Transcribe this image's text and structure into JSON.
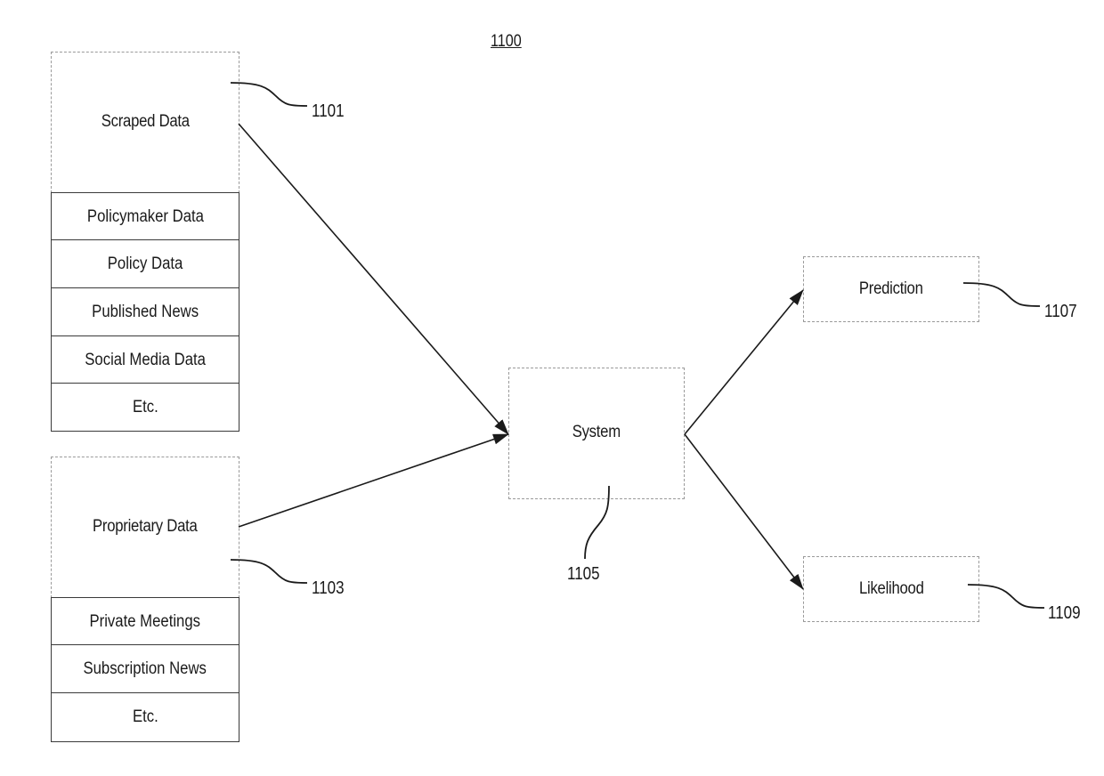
{
  "figure_number": "1100",
  "scraped": {
    "title": "Scraped Data",
    "ref": "1101",
    "items": [
      "Policymaker Data",
      "Policy Data",
      "Published News",
      "Social Media Data",
      "Etc."
    ]
  },
  "proprietary": {
    "title": "Proprietary Data",
    "ref": "1103",
    "items": [
      "Private Meetings",
      "Subscription News",
      "Etc."
    ]
  },
  "system": {
    "title": "System",
    "ref": "1105"
  },
  "prediction": {
    "title": "Prediction",
    "ref": "1107"
  },
  "likelihood": {
    "title": "Likelihood",
    "ref": "1109"
  },
  "edges": [
    {
      "from": "scraped",
      "to": "system"
    },
    {
      "from": "proprietary",
      "to": "system"
    },
    {
      "from": "system",
      "to": "prediction"
    },
    {
      "from": "system",
      "to": "likelihood"
    }
  ],
  "colors": {
    "line": "#1a1a1a",
    "box_border": "#9a9a9a",
    "row_border": "#3a3a3a"
  }
}
